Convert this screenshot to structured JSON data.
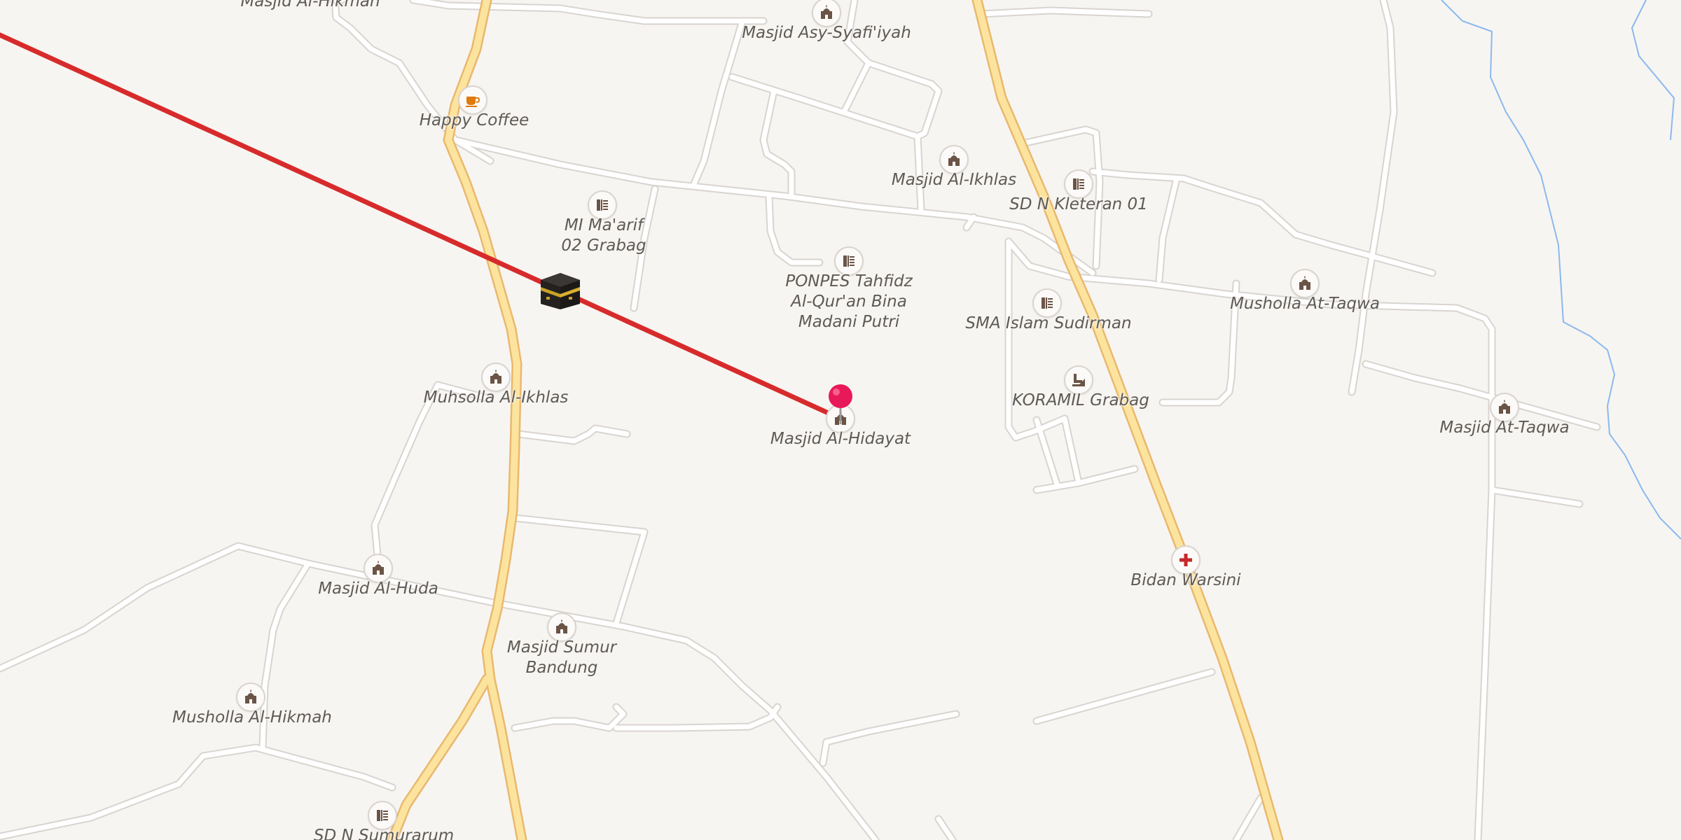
{
  "map": {
    "colors": {
      "background": "#f7f5f2",
      "road_minor": "#ffffff",
      "road_minor_casing": "#d8d4cf",
      "road_major": "#fde49e",
      "road_major_casing": "#e9b86e",
      "water": "#8ab9ee",
      "route_line": "#d72b2b",
      "poi_icon": "#6b5446",
      "cafe_icon": "#e07a0b",
      "medical_icon": "#c62828",
      "pin": "#e8195a"
    },
    "pois": [
      {
        "label": "Masjid Al-Hikmah",
        "icon": "mosque-icon"
      },
      {
        "label": "Masjid Asy-Syafi'iyah",
        "icon": "mosque-icon"
      },
      {
        "label": "Happy Coffee",
        "icon": "cafe-icon"
      },
      {
        "label": "MI Ma'arif\n02 Grabag",
        "icon": "school-icon"
      },
      {
        "label": "PONPES Tahfidz\nAl-Qur'an Bina\nMadani Putri",
        "icon": "school-icon"
      },
      {
        "label": "Masjid Al-Ikhlas",
        "icon": "mosque-icon"
      },
      {
        "label": "SD N Kleteran 01",
        "icon": "school-icon"
      },
      {
        "label": "SMA Islam Sudirman",
        "icon": "school-icon"
      },
      {
        "label": "Musholla At-Taqwa",
        "icon": "mosque-icon"
      },
      {
        "label": "Muhsolla Al-Ikhlas",
        "icon": "mosque-icon"
      },
      {
        "label": "KORAMIL Grabag",
        "icon": "military-icon"
      },
      {
        "label": "Masjid Al-Hidayat",
        "icon": "mosque-icon"
      },
      {
        "label": "Masjid At-Taqwa",
        "icon": "mosque-icon"
      },
      {
        "label": "Masjid Al-Huda",
        "icon": "mosque-icon"
      },
      {
        "label": "Masjid Sumur\nBandung",
        "icon": "mosque-icon"
      },
      {
        "label": "Bidan Warsini",
        "icon": "medical-icon"
      },
      {
        "label": "Musholla Al-Hikmah",
        "icon": "mosque-icon"
      },
      {
        "label": "SD N Sumurarum",
        "icon": "school-icon"
      }
    ],
    "markers": {
      "qibla": {
        "icon": "kaaba-icon"
      },
      "location": {
        "icon": "map-pin-icon"
      }
    }
  }
}
